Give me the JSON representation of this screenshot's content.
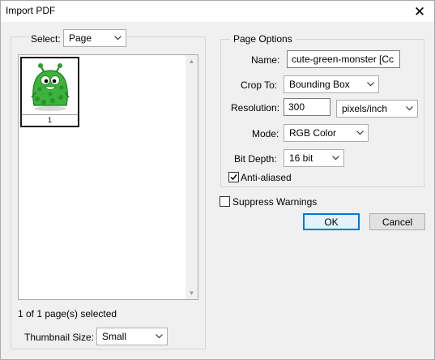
{
  "window": {
    "title": "Import PDF",
    "close_glyph": "✕"
  },
  "left": {
    "select_label": "Select:",
    "select_value": "Page",
    "thumbnails": [
      {
        "page_number": "1",
        "image": "cute-green-monster"
      }
    ],
    "selection_status": "1 of 1 page(s) selected",
    "thumbnail_size_label": "Thumbnail Size:",
    "thumbnail_size_value": "Small"
  },
  "page_options": {
    "legend": "Page Options",
    "name_label": "Name:",
    "name_value": "cute-green-monster [Cc",
    "crop_to_label": "Crop To:",
    "crop_to_value": "Bounding Box",
    "resolution_label": "Resolution:",
    "resolution_value": "300",
    "resolution_unit": "pixels/inch",
    "mode_label": "Mode:",
    "mode_value": "RGB Color",
    "bit_depth_label": "Bit Depth:",
    "bit_depth_value": "16 bit",
    "anti_aliased_label": "Anti-aliased",
    "anti_aliased_checked": true
  },
  "suppress_warnings_label": "Suppress Warnings",
  "suppress_warnings_checked": false,
  "buttons": {
    "ok": "OK",
    "cancel": "Cancel"
  },
  "colors": {
    "focus_border": "#0078d7",
    "monster_green": "#3cb33c"
  }
}
